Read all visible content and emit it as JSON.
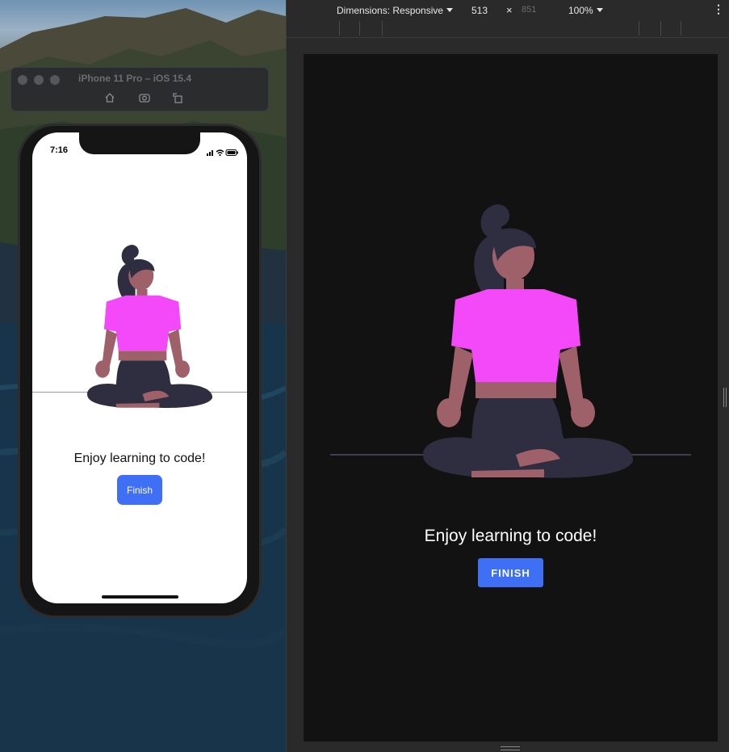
{
  "simulator": {
    "title": "iPhone 11 Pro – iOS 15.4",
    "status_time": "7:16",
    "buttons": [
      "home-icon",
      "screenshot-icon",
      "rotate-icon"
    ]
  },
  "phone_app": {
    "heading": "Enjoy learning to code!",
    "button_label": "Finish"
  },
  "devtools": {
    "dimensions_label": "Dimensions: Responsive",
    "width": "513",
    "times": "×",
    "height": "851",
    "zoom": "100%",
    "more": "⋮"
  },
  "viewport_app": {
    "heading": "Enjoy learning to code!",
    "button_label": "FINISH"
  },
  "colors": {
    "accent": "#3e6ff5",
    "shirt": "#f349f9",
    "skin": "#9e616a",
    "dark": "#2f2e41"
  }
}
